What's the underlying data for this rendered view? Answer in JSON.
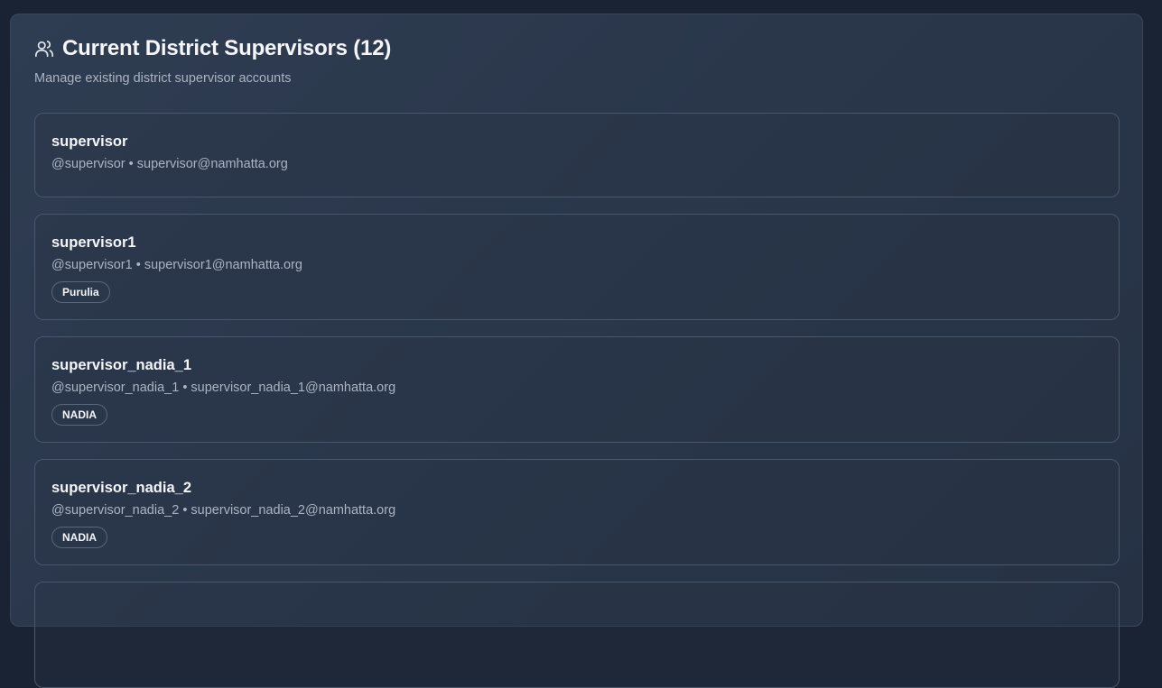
{
  "header": {
    "title": "Current District Supervisors (12)",
    "subtitle": "Manage existing district supervisor accounts",
    "icon": "users-icon"
  },
  "supervisors": [
    {
      "name": "supervisor",
      "username": "@supervisor",
      "separator": "•",
      "email": "supervisor@namhatta.org",
      "district": ""
    },
    {
      "name": "supervisor1",
      "username": "@supervisor1",
      "separator": "•",
      "email": "supervisor1@namhatta.org",
      "district": "Purulia"
    },
    {
      "name": "supervisor_nadia_1",
      "username": "@supervisor_nadia_1",
      "separator": "•",
      "email": "supervisor_nadia_1@namhatta.org",
      "district": "NADIA"
    },
    {
      "name": "supervisor_nadia_2",
      "username": "@supervisor_nadia_2",
      "separator": "•",
      "email": "supervisor_nadia_2@namhatta.org",
      "district": "NADIA"
    }
  ]
}
